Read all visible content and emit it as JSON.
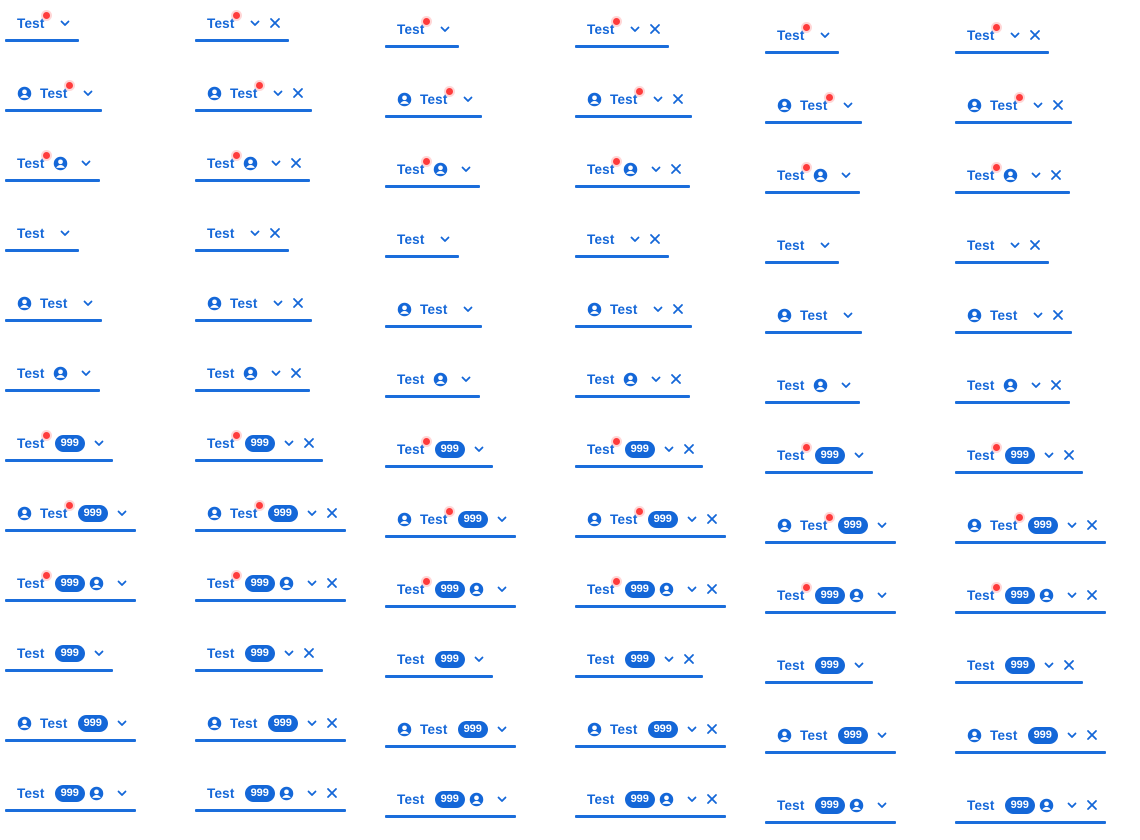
{
  "tab_label": "Test",
  "badge_count": "999",
  "accent_color": "#1467d8",
  "dot_color": "#ff3b3b",
  "icons": {
    "avatar": "user-circle-icon",
    "chevron": "chevron-down-icon",
    "close": "close-icon"
  }
}
